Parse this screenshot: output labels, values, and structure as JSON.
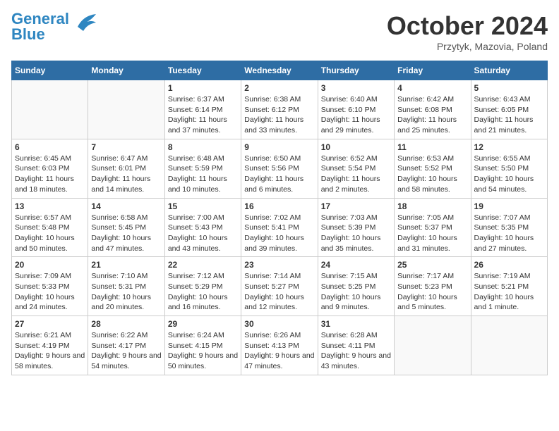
{
  "header": {
    "logo_line1": "General",
    "logo_line2": "Blue",
    "month": "October 2024",
    "location": "Przytyk, Mazovia, Poland"
  },
  "weekdays": [
    "Sunday",
    "Monday",
    "Tuesday",
    "Wednesday",
    "Thursday",
    "Friday",
    "Saturday"
  ],
  "weeks": [
    [
      {
        "day": "",
        "info": ""
      },
      {
        "day": "",
        "info": ""
      },
      {
        "day": "1",
        "info": "Sunrise: 6:37 AM\nSunset: 6:14 PM\nDaylight: 11 hours and 37 minutes."
      },
      {
        "day": "2",
        "info": "Sunrise: 6:38 AM\nSunset: 6:12 PM\nDaylight: 11 hours and 33 minutes."
      },
      {
        "day": "3",
        "info": "Sunrise: 6:40 AM\nSunset: 6:10 PM\nDaylight: 11 hours and 29 minutes."
      },
      {
        "day": "4",
        "info": "Sunrise: 6:42 AM\nSunset: 6:08 PM\nDaylight: 11 hours and 25 minutes."
      },
      {
        "day": "5",
        "info": "Sunrise: 6:43 AM\nSunset: 6:05 PM\nDaylight: 11 hours and 21 minutes."
      }
    ],
    [
      {
        "day": "6",
        "info": "Sunrise: 6:45 AM\nSunset: 6:03 PM\nDaylight: 11 hours and 18 minutes."
      },
      {
        "day": "7",
        "info": "Sunrise: 6:47 AM\nSunset: 6:01 PM\nDaylight: 11 hours and 14 minutes."
      },
      {
        "day": "8",
        "info": "Sunrise: 6:48 AM\nSunset: 5:59 PM\nDaylight: 11 hours and 10 minutes."
      },
      {
        "day": "9",
        "info": "Sunrise: 6:50 AM\nSunset: 5:56 PM\nDaylight: 11 hours and 6 minutes."
      },
      {
        "day": "10",
        "info": "Sunrise: 6:52 AM\nSunset: 5:54 PM\nDaylight: 11 hours and 2 minutes."
      },
      {
        "day": "11",
        "info": "Sunrise: 6:53 AM\nSunset: 5:52 PM\nDaylight: 10 hours and 58 minutes."
      },
      {
        "day": "12",
        "info": "Sunrise: 6:55 AM\nSunset: 5:50 PM\nDaylight: 10 hours and 54 minutes."
      }
    ],
    [
      {
        "day": "13",
        "info": "Sunrise: 6:57 AM\nSunset: 5:48 PM\nDaylight: 10 hours and 50 minutes."
      },
      {
        "day": "14",
        "info": "Sunrise: 6:58 AM\nSunset: 5:45 PM\nDaylight: 10 hours and 47 minutes."
      },
      {
        "day": "15",
        "info": "Sunrise: 7:00 AM\nSunset: 5:43 PM\nDaylight: 10 hours and 43 minutes."
      },
      {
        "day": "16",
        "info": "Sunrise: 7:02 AM\nSunset: 5:41 PM\nDaylight: 10 hours and 39 minutes."
      },
      {
        "day": "17",
        "info": "Sunrise: 7:03 AM\nSunset: 5:39 PM\nDaylight: 10 hours and 35 minutes."
      },
      {
        "day": "18",
        "info": "Sunrise: 7:05 AM\nSunset: 5:37 PM\nDaylight: 10 hours and 31 minutes."
      },
      {
        "day": "19",
        "info": "Sunrise: 7:07 AM\nSunset: 5:35 PM\nDaylight: 10 hours and 27 minutes."
      }
    ],
    [
      {
        "day": "20",
        "info": "Sunrise: 7:09 AM\nSunset: 5:33 PM\nDaylight: 10 hours and 24 minutes."
      },
      {
        "day": "21",
        "info": "Sunrise: 7:10 AM\nSunset: 5:31 PM\nDaylight: 10 hours and 20 minutes."
      },
      {
        "day": "22",
        "info": "Sunrise: 7:12 AM\nSunset: 5:29 PM\nDaylight: 10 hours and 16 minutes."
      },
      {
        "day": "23",
        "info": "Sunrise: 7:14 AM\nSunset: 5:27 PM\nDaylight: 10 hours and 12 minutes."
      },
      {
        "day": "24",
        "info": "Sunrise: 7:15 AM\nSunset: 5:25 PM\nDaylight: 10 hours and 9 minutes."
      },
      {
        "day": "25",
        "info": "Sunrise: 7:17 AM\nSunset: 5:23 PM\nDaylight: 10 hours and 5 minutes."
      },
      {
        "day": "26",
        "info": "Sunrise: 7:19 AM\nSunset: 5:21 PM\nDaylight: 10 hours and 1 minute."
      }
    ],
    [
      {
        "day": "27",
        "info": "Sunrise: 6:21 AM\nSunset: 4:19 PM\nDaylight: 9 hours and 58 minutes."
      },
      {
        "day": "28",
        "info": "Sunrise: 6:22 AM\nSunset: 4:17 PM\nDaylight: 9 hours and 54 minutes."
      },
      {
        "day": "29",
        "info": "Sunrise: 6:24 AM\nSunset: 4:15 PM\nDaylight: 9 hours and 50 minutes."
      },
      {
        "day": "30",
        "info": "Sunrise: 6:26 AM\nSunset: 4:13 PM\nDaylight: 9 hours and 47 minutes."
      },
      {
        "day": "31",
        "info": "Sunrise: 6:28 AM\nSunset: 4:11 PM\nDaylight: 9 hours and 43 minutes."
      },
      {
        "day": "",
        "info": ""
      },
      {
        "day": "",
        "info": ""
      }
    ]
  ]
}
